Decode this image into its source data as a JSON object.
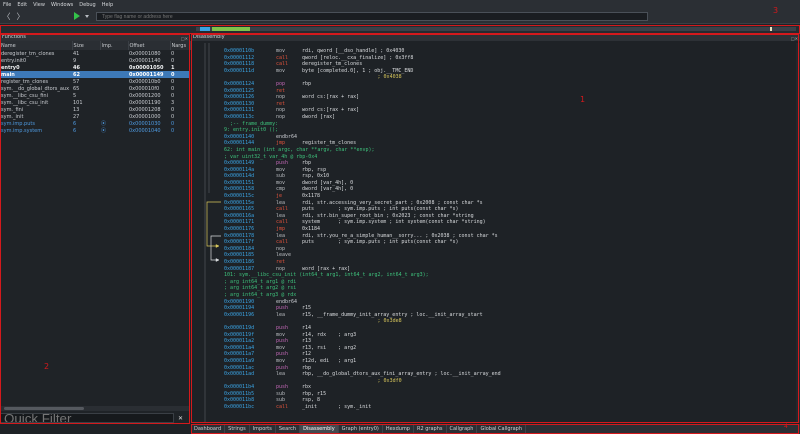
{
  "menu": [
    "File",
    "Edit",
    "View",
    "Windows",
    "Debug",
    "Help"
  ],
  "search": {
    "placeholder": "Type flag name or address here"
  },
  "functions_panel": {
    "title": "Functions",
    "columns": [
      "Name",
      "Size",
      "Imp.",
      "Offset",
      "Nargs"
    ],
    "rows": [
      {
        "name": "deregister_tm_clones",
        "size": "41",
        "imp": "",
        "offset": "0x00001080",
        "nargs": "0",
        "style": "normal"
      },
      {
        "name": "entry.init0",
        "size": "9",
        "imp": "",
        "offset": "0x00001140",
        "nargs": "0",
        "style": "normal"
      },
      {
        "name": "entry0",
        "size": "46",
        "imp": "",
        "offset": "0x00001050",
        "nargs": "1",
        "style": "bold"
      },
      {
        "name": "main",
        "size": "62",
        "imp": "",
        "offset": "0x00001149",
        "nargs": "0",
        "style": "selected"
      },
      {
        "name": "register_tm_clones",
        "size": "57",
        "imp": "",
        "offset": "0x000010b0",
        "nargs": "0",
        "style": "normal"
      },
      {
        "name": "sym.__do_global_dtors_aux",
        "size": "65",
        "imp": "",
        "offset": "0x000010f0",
        "nargs": "0",
        "style": "normal"
      },
      {
        "name": "sym.__libc_csu_fini",
        "size": "5",
        "imp": "",
        "offset": "0x00001200",
        "nargs": "0",
        "style": "normal"
      },
      {
        "name": "sym.__libc_csu_init",
        "size": "101",
        "imp": "",
        "offset": "0x00001190",
        "nargs": "3",
        "style": "normal"
      },
      {
        "name": "sym._fini",
        "size": "13",
        "imp": "",
        "offset": "0x00001208",
        "nargs": "0",
        "style": "normal"
      },
      {
        "name": "sym._init",
        "size": "27",
        "imp": "",
        "offset": "0x00001000",
        "nargs": "0",
        "style": "normal"
      },
      {
        "name": "sym.imp.puts",
        "size": "6",
        "imp": "⦿",
        "offset": "0x00001030",
        "nargs": "0",
        "style": "import"
      },
      {
        "name": "sym.imp.system",
        "size": "6",
        "imp": "⦿",
        "offset": "0x00001040",
        "nargs": "0",
        "style": "import"
      }
    ],
    "quick_filter_placeholder": "Quick Filter"
  },
  "disassembly": {
    "title": "Disassembly",
    "lines": [
      {
        "t": "i",
        "a": "0x0000110b",
        "m": "mov",
        "o": "rdi, qword [__dso_handle] ; 0x4030"
      },
      {
        "t": "i",
        "a": "0x00001112",
        "m": "call",
        "o": "qword [reloc.__cxa_finalize] ; 0x3ff8"
      },
      {
        "t": "i",
        "a": "0x00001118",
        "m": "call",
        "o": "deregister_tm_clones"
      },
      {
        "t": "i",
        "a": "0x0000111d",
        "m": "mov",
        "o": "byte [completed.0], 1 ; obj.__TMC_END"
      },
      {
        "t": "c",
        "x": "                                                   ; 0x4038"
      },
      {
        "t": "i",
        "a": "0x00001124",
        "m": "pop",
        "o": "rbp"
      },
      {
        "t": "i",
        "a": "0x00001125",
        "m": "ret",
        "o": ""
      },
      {
        "t": "i",
        "a": "0x00001126",
        "m": "nop",
        "o": "word cs:[rax + rax]"
      },
      {
        "t": "i",
        "a": "0x00001130",
        "m": "ret",
        "o": ""
      },
      {
        "t": "i",
        "a": "0x00001131",
        "m": "nop",
        "o": "word cs:[rax + rax]"
      },
      {
        "t": "i",
        "a": "0x0000113c",
        "m": "nop",
        "o": "dword [rax]"
      },
      {
        "t": "l",
        "x": "  ;-- frame_dummy:"
      },
      {
        "t": "l",
        "x": "9: entry.init0 ();"
      },
      {
        "t": "i",
        "a": "0x00001140",
        "m": "endbr64",
        "o": ""
      },
      {
        "t": "i",
        "a": "0x00001144",
        "m": "jmp",
        "o": "register_tm_clones"
      },
      {
        "t": "l",
        "x": "62: int main (int argc, char **argv, char **envp);"
      },
      {
        "t": "l",
        "x": "; var uint32_t var_4h @ rbp-0x4"
      },
      {
        "t": "i",
        "a": "0x00001149",
        "m": "push",
        "o": "rbp"
      },
      {
        "t": "i",
        "a": "0x0000114a",
        "m": "mov",
        "o": "rbp, rsp"
      },
      {
        "t": "i",
        "a": "0x0000114d",
        "m": "sub",
        "o": "rsp, 0x10"
      },
      {
        "t": "i",
        "a": "0x00001151",
        "m": "mov",
        "o": "dword [var_4h], 0"
      },
      {
        "t": "i",
        "a": "0x00001158",
        "m": "cmp",
        "o": "dword [var_4h], 0"
      },
      {
        "t": "i",
        "a": "0x0000115c",
        "m": "je",
        "o": "0x1178"
      },
      {
        "t": "i",
        "a": "0x0000115e",
        "m": "lea",
        "o": "rdi, str.accessing_very_secret_part ; 0x2008 ; const char *s"
      },
      {
        "t": "i",
        "a": "0x00001165",
        "m": "call",
        "o": "puts        ; sym.imp.puts ; int puts(const char *s)"
      },
      {
        "t": "i",
        "a": "0x0000116a",
        "m": "lea",
        "o": "rdi, str.bin_super_root_bin ; 0x2023 ; const char *string"
      },
      {
        "t": "i",
        "a": "0x00001171",
        "m": "call",
        "o": "system      ; sym.imp.system ; int system(const char *string)"
      },
      {
        "t": "i",
        "a": "0x00001176",
        "m": "jmp",
        "o": "0x1184"
      },
      {
        "t": "i",
        "a": "0x00001178",
        "m": "lea",
        "o": "rdi, str.you_re_a_simple_human__sorry... ; 0x2038 ; const char *s"
      },
      {
        "t": "i",
        "a": "0x0000117f",
        "m": "call",
        "o": "puts        ; sym.imp.puts ; int puts(const char *s)"
      },
      {
        "t": "i",
        "a": "0x00001184",
        "m": "nop",
        "o": ""
      },
      {
        "t": "i",
        "a": "0x00001185",
        "m": "leave",
        "o": ""
      },
      {
        "t": "i",
        "a": "0x00001186",
        "m": "ret",
        "o": ""
      },
      {
        "t": "i",
        "a": "0x00001187",
        "m": "nop",
        "o": "word [rax + rax]"
      },
      {
        "t": "l",
        "x": "101: sym.__libc_csu_init (int64_t arg1, int64_t arg2, int64_t arg3);"
      },
      {
        "t": "l",
        "x": "; arg int64_t arg1 @ rdi"
      },
      {
        "t": "l",
        "x": "; arg int64_t arg2 @ rsi"
      },
      {
        "t": "l",
        "x": "; arg int64_t arg3 @ rdx"
      },
      {
        "t": "i",
        "a": "0x00001190",
        "m": "endbr64",
        "o": ""
      },
      {
        "t": "i",
        "a": "0x00001194",
        "m": "push",
        "o": "r15"
      },
      {
        "t": "i",
        "a": "0x00001196",
        "m": "lea",
        "o": "r15, __frame_dummy_init_array_entry ; loc.__init_array_start"
      },
      {
        "t": "c",
        "x": "                                                   ; 0x3de8"
      },
      {
        "t": "i",
        "a": "0x0000119d",
        "m": "push",
        "o": "r14"
      },
      {
        "t": "i",
        "a": "0x0000119f",
        "m": "mov",
        "o": "r14, rdx    ; arg3"
      },
      {
        "t": "i",
        "a": "0x000011a2",
        "m": "push",
        "o": "r13"
      },
      {
        "t": "i",
        "a": "0x000011a4",
        "m": "mov",
        "o": "r13, rsi    ; arg2"
      },
      {
        "t": "i",
        "a": "0x000011a7",
        "m": "push",
        "o": "r12"
      },
      {
        "t": "i",
        "a": "0x000011a9",
        "m": "mov",
        "o": "r12d, edi   ; arg1"
      },
      {
        "t": "i",
        "a": "0x000011ac",
        "m": "push",
        "o": "rbp"
      },
      {
        "t": "i",
        "a": "0x000011ad",
        "m": "lea",
        "o": "rbp, __do_global_dtors_aux_fini_array_entry ; loc.__init_array_end"
      },
      {
        "t": "c",
        "x": "                                                   ; 0x3df0"
      },
      {
        "t": "i",
        "a": "0x000011b4",
        "m": "push",
        "o": "rbx"
      },
      {
        "t": "i",
        "a": "0x000011b5",
        "m": "sub",
        "o": "rbp, r15"
      },
      {
        "t": "i",
        "a": "0x000011b8",
        "m": "sub",
        "o": "rsp, 8"
      },
      {
        "t": "i",
        "a": "0x000011bc",
        "m": "call",
        "o": "_init       ; sym._init"
      }
    ]
  },
  "bottom_tabs": [
    {
      "label": "Dashboard",
      "active": false
    },
    {
      "label": "Strings",
      "active": false
    },
    {
      "label": "Imports",
      "active": false
    },
    {
      "label": "Search",
      "active": false
    },
    {
      "label": "Disassembly",
      "active": true
    },
    {
      "label": "Graph (entry0)",
      "active": false
    },
    {
      "label": "Hexdump",
      "active": false
    },
    {
      "label": "R2 graphs",
      "active": false
    },
    {
      "label": "Callgraph",
      "active": false
    },
    {
      "label": "Global Callgraph",
      "active": false
    }
  ],
  "annotations": [
    "1",
    "2",
    "3",
    "4"
  ]
}
